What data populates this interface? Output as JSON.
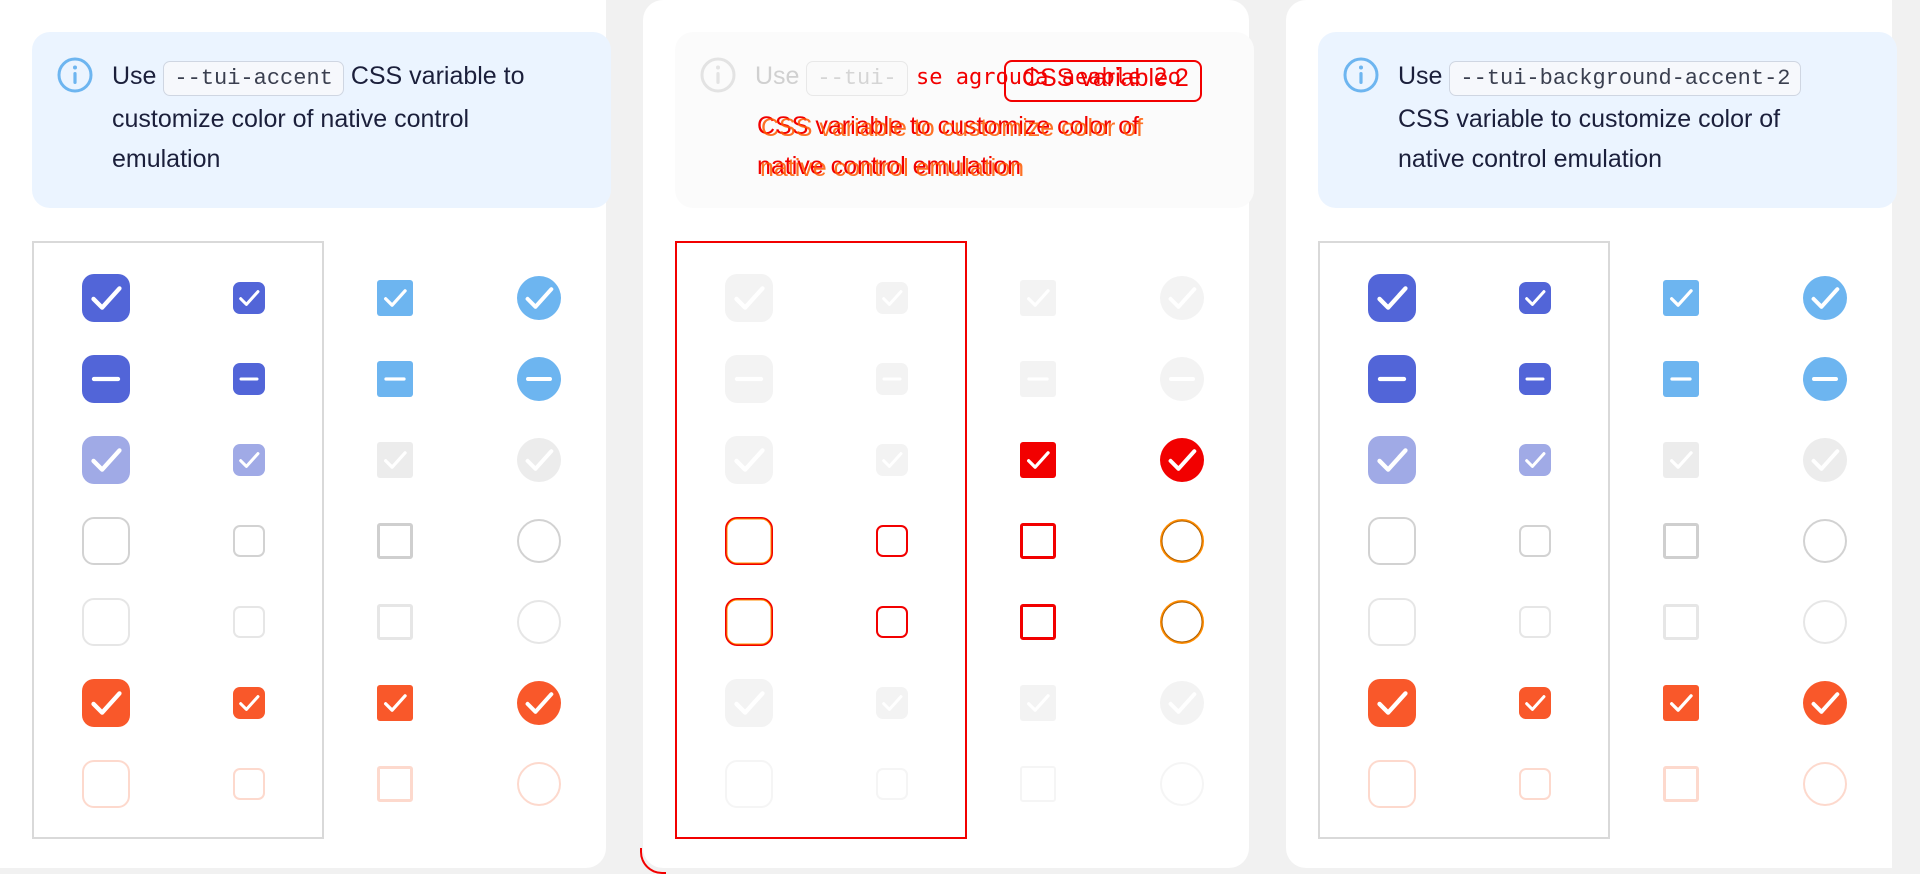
{
  "panels": [
    {
      "id": "accent",
      "notice": {
        "prefix": "Use",
        "code": "--tui-accent",
        "line1_rest": "CSS variable to",
        "line2": "customize color of native control",
        "line3": "emulation"
      }
    },
    {
      "id": "background",
      "notice": {
        "prefix": "Use",
        "code": "--tui-",
        "overlay_top": "se agrouda aeable 2o",
        "overlay_box": "CSS variable 2",
        "overlay_line2": "CSS variable to  customize color of",
        "overlay_line3": "native control emulation"
      }
    },
    {
      "id": "background-accent-2",
      "notice": {
        "prefix": "Use",
        "code": "--tui-background-accent-2",
        "line2": "CSS variable to customize color of",
        "line3": "native control emulation"
      }
    }
  ],
  "colors": {
    "primary": "#5265d8",
    "primary_light": "#a0aae6",
    "secondary": "#6db5f0",
    "orange": "#f9582a",
    "orange_light": "#fdd9cd",
    "disabled": "#ececec",
    "border": "#d2d2d2",
    "highlight_red": "#f20000",
    "highlight_orange": "#ff8c00"
  },
  "controls": {
    "rows": [
      "checked",
      "indeterminate",
      "checked-disabled",
      "unchecked",
      "unchecked-disabled",
      "checked-error",
      "unchecked-error"
    ],
    "columns": [
      "checkbox-large",
      "checkbox-small",
      "native-checkbox",
      "native-radio"
    ]
  }
}
